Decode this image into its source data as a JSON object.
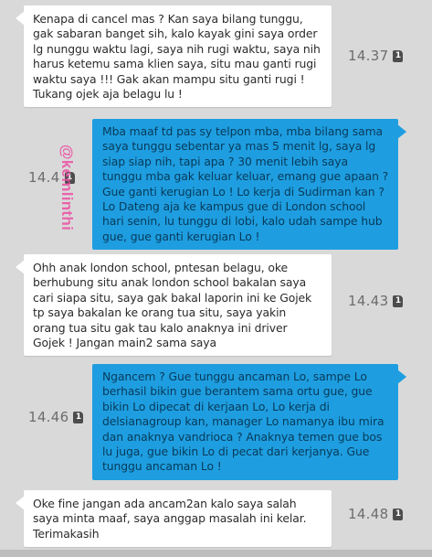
{
  "watermark": "@kemlinthi",
  "sim_icon_label": "1",
  "messages": [
    {
      "direction": "incoming",
      "time": "14.37",
      "lines": [
        "Kenapa di cancel mas ? Kan saya bilang tunggu,",
        "gak sabaran banget sih, kalo kayak gini saya order",
        "lg nunggu waktu lagi, saya nih rugi waktu, saya nih",
        "harus ketemu sama klien saya, situ mau ganti rugi",
        "waktu saya !!! Gak akan mampu situ ganti rugi !",
        "Tukang ojek aja belagu lu !"
      ]
    },
    {
      "direction": "outgoing",
      "time": "14.4",
      "lines": [
        "Mba maaf td pas sy telpon mba, mba bilang sama",
        "saya tunggu sebentar ya mas 5 menit lg, saya lg",
        "siap siap nih, tapi apa ? 30 menit lebih saya",
        "tunggu mba gak keluar keluar, emang gue apaan ?",
        "Gue ganti kerugian Lo ! Lo kerja di Sudirman kan ?",
        "Lo Dateng aja ke kampus gue di London school",
        "hari senin, lu tunggu di lobi, kalo udah sampe hub",
        "gue, gue ganti kerugian Lo !"
      ]
    },
    {
      "direction": "incoming",
      "time": "14.43",
      "lines": [
        "Ohh anak london school, pntesan belagu, oke",
        "berhubung situ anak london school bakalan saya",
        "cari siapa situ, saya gak bakal laporin ini ke Gojek",
        "tp saya bakalan ke orang tua situ, saya yakin",
        "orang tua situ gak tau kalo anaknya ini driver",
        "Gojek ! Jangan main2 sama saya"
      ]
    },
    {
      "direction": "outgoing",
      "time": "14.46",
      "lines": [
        "Ngancem ? Gue tunggu ancaman Lo, sampe Lo",
        "berhasil bikin gue berantem sama ortu gue, gue",
        "bikin Lo dipecat di kerjaan Lo, Lo kerja di",
        "delsianagroup kan, manager Lo namanya ibu mira",
        "dan anaknya vandrioca ? Anaknya temen gue bos",
        "lu juga, gue bikin Lo di pecat dari kerjanya. Gue",
        "tunggu ancaman Lo !"
      ]
    },
    {
      "direction": "incoming",
      "time": "14.48",
      "lines": [
        "Oke fine jangan ada ancam2an kalo saya salah",
        "saya minta maaf, saya anggap masalah ini kelar.",
        "Terimakasih"
      ]
    }
  ]
}
